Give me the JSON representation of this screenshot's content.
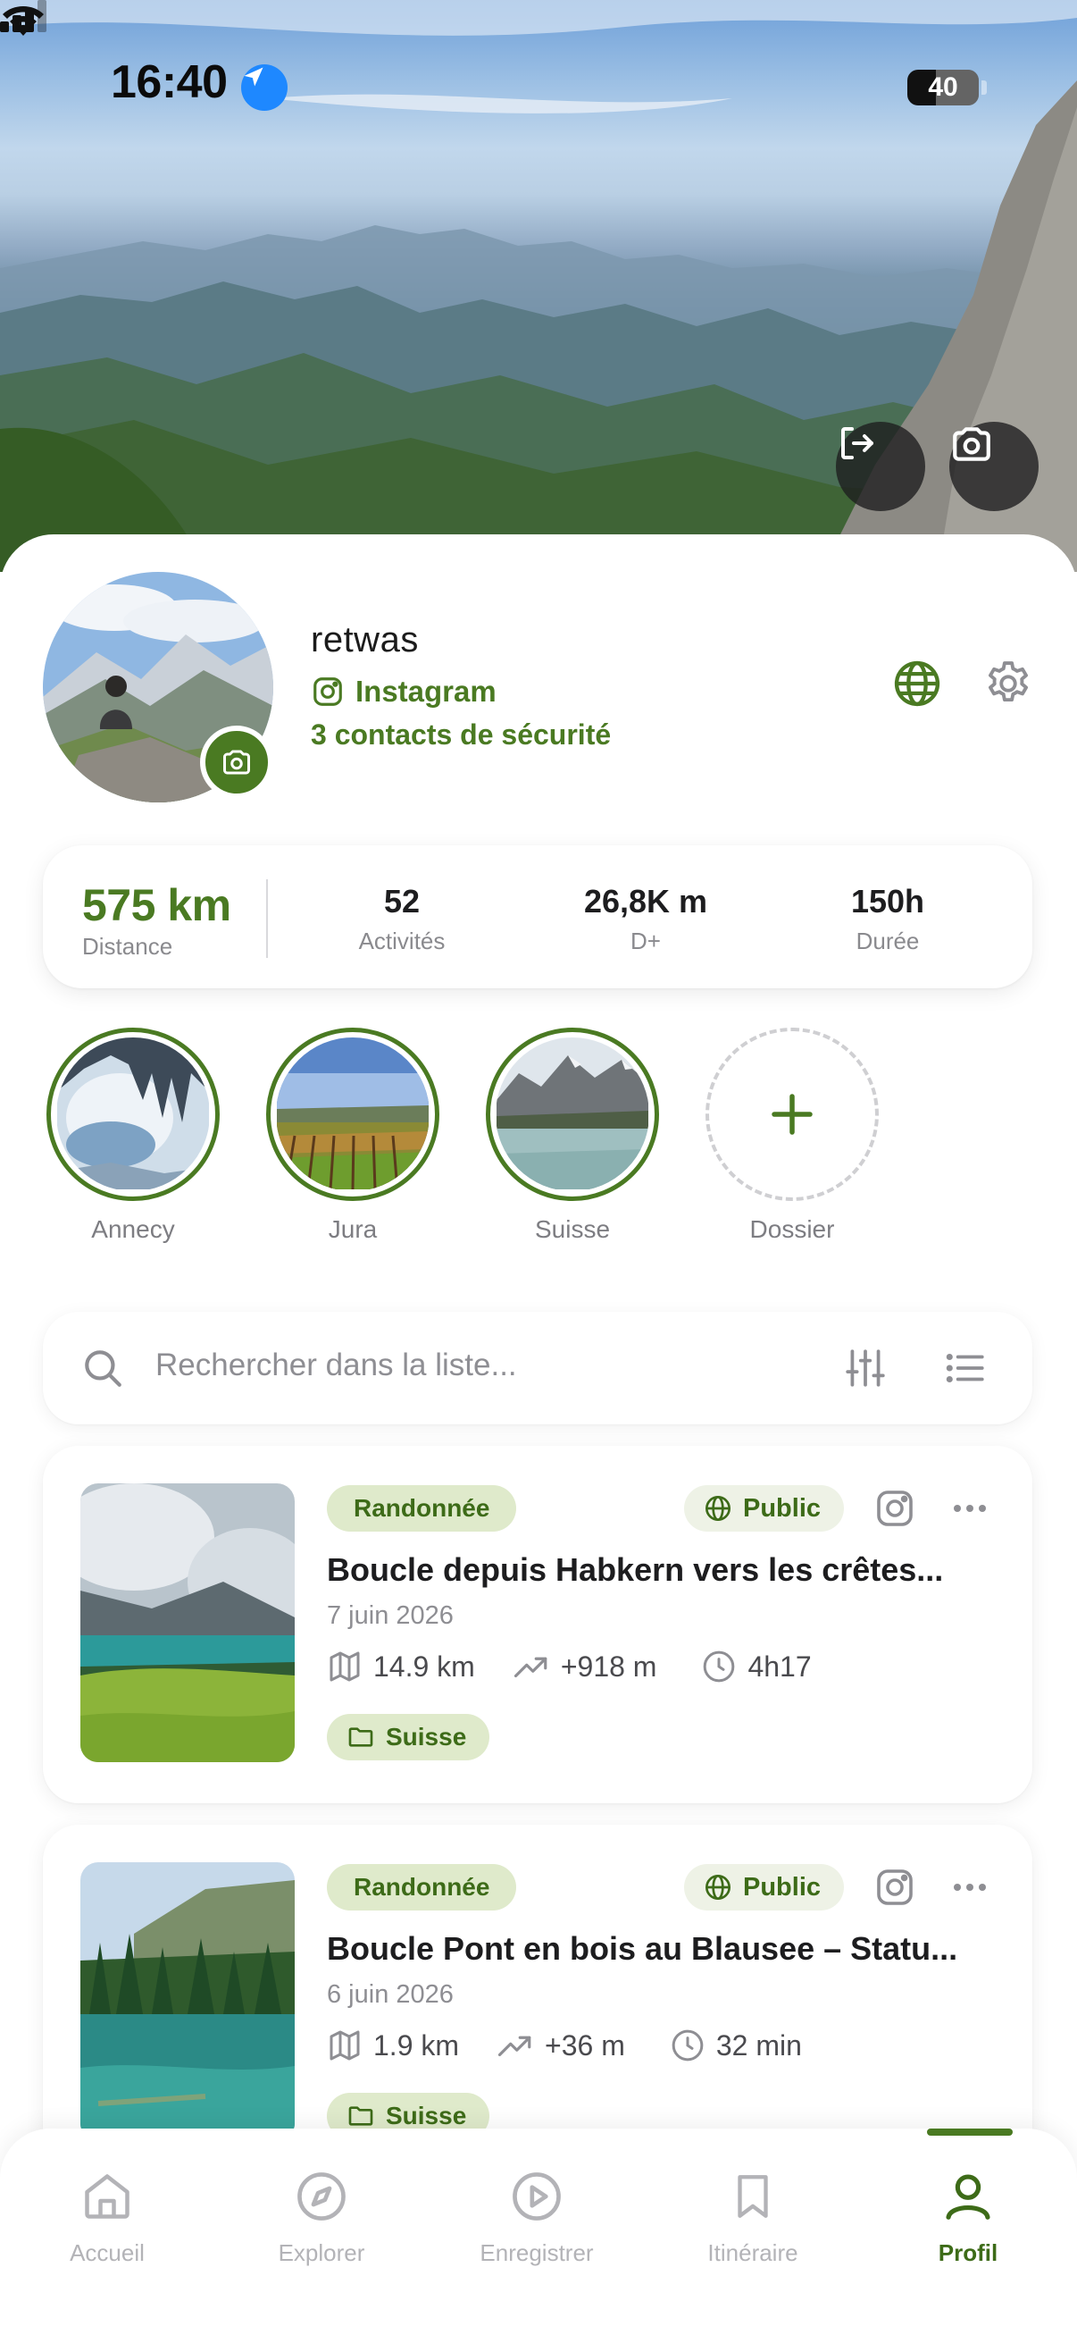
{
  "status_bar": {
    "time": "16:40",
    "battery": "40",
    "battery_level": 0.4
  },
  "profile": {
    "username": "retwas",
    "instagram_label": "Instagram",
    "safety_contacts": "3 contacts de sécurité"
  },
  "stats": {
    "distance": {
      "value": "575 km",
      "label": "Distance"
    },
    "activities": {
      "value": "52",
      "label": "Activités"
    },
    "elevation": {
      "value": "26,8K m",
      "label": "D+"
    },
    "duration": {
      "value": "150h",
      "label": "Durée"
    }
  },
  "folders": [
    {
      "name": "Annecy"
    },
    {
      "name": "Jura"
    },
    {
      "name": "Suisse"
    },
    {
      "name": "Dossier"
    }
  ],
  "search": {
    "placeholder": "Rechercher dans la liste..."
  },
  "activities": [
    {
      "type": "Randonnée",
      "visibility": "Public",
      "title": "Boucle depuis Habkern vers les crêtes...",
      "date": "7 juin 2026",
      "distance": "14.9 km",
      "elevation": "+918 m",
      "duration": "4h17",
      "folder": "Suisse"
    },
    {
      "type": "Randonnée",
      "visibility": "Public",
      "title": "Boucle Pont en bois au Blausee – Statu...",
      "date": "6 juin 2026",
      "distance": "1.9 km",
      "elevation": "+36 m",
      "duration": "32 min",
      "folder": "Suisse"
    }
  ],
  "tabs": [
    {
      "label": "Accueil",
      "icon": "home-icon"
    },
    {
      "label": "Explorer",
      "icon": "compass-icon"
    },
    {
      "label": "Enregistrer",
      "icon": "record-icon"
    },
    {
      "label": "Itinéraire",
      "icon": "bookmark-icon"
    },
    {
      "label": "Profil",
      "icon": "person-icon",
      "active": true
    }
  ],
  "colors": {
    "accent": "#4a7a22",
    "chip_bg": "#dfeacb",
    "muted_text": "#8e8e93"
  }
}
